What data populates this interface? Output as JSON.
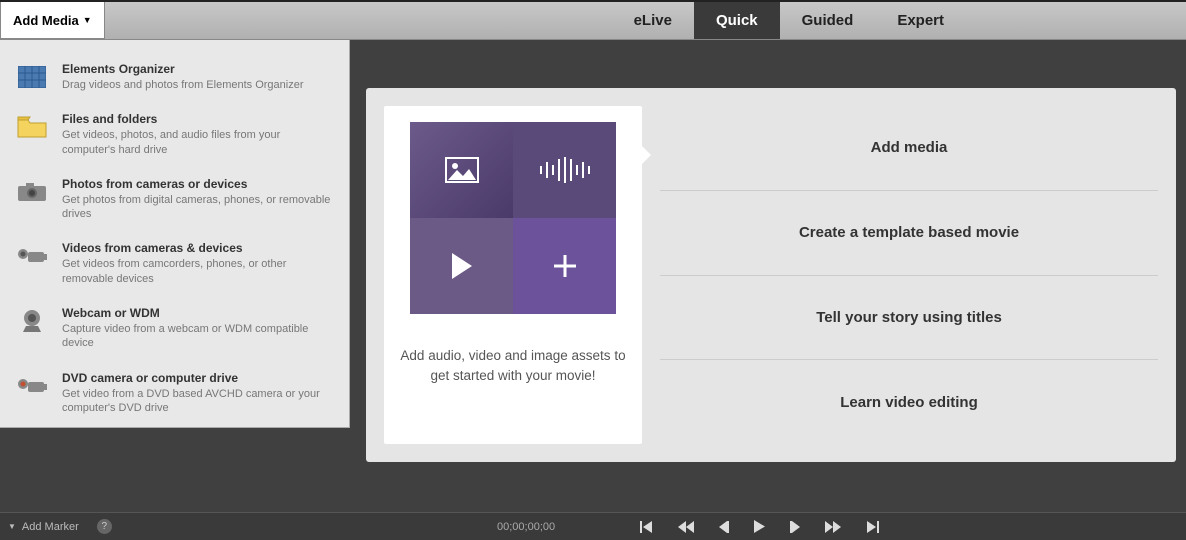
{
  "topbar": {
    "addMediaLabel": "Add Media",
    "tabs": [
      {
        "id": "elive",
        "label": "eLive",
        "active": false
      },
      {
        "id": "quick",
        "label": "Quick",
        "active": true
      },
      {
        "id": "guided",
        "label": "Guided",
        "active": false
      },
      {
        "id": "expert",
        "label": "Expert",
        "active": false
      }
    ]
  },
  "dropdown": {
    "items": [
      {
        "icon": "grid",
        "title": "Elements Organizer",
        "desc": "Drag videos and photos from Elements Organizer"
      },
      {
        "icon": "folder",
        "title": "Files and folders",
        "desc": "Get videos, photos, and audio files from your computer's hard drive"
      },
      {
        "icon": "camera",
        "title": "Photos from cameras or devices",
        "desc": "Get photos from digital cameras, phones, or removable drives"
      },
      {
        "icon": "camcorder",
        "title": "Videos from cameras & devices",
        "desc": "Get videos from camcorders, phones, or other removable devices"
      },
      {
        "icon": "webcam",
        "title": "Webcam or WDM",
        "desc": "Capture video from a webcam or WDM compatible device"
      },
      {
        "icon": "dvdcam",
        "title": "DVD camera or computer drive",
        "desc": "Get video from a DVD based AVCHD camera or your computer's DVD drive"
      }
    ]
  },
  "welcome": {
    "cardCaption": "Add audio, video and image assets to get started with your movie!",
    "options": [
      "Add media",
      "Create a template based movie",
      "Tell your story using titles",
      "Learn video editing"
    ]
  },
  "bottombar": {
    "addMarkerLabel": "Add Marker",
    "helpLabel": "?",
    "timecode": "00;00;00;00"
  }
}
